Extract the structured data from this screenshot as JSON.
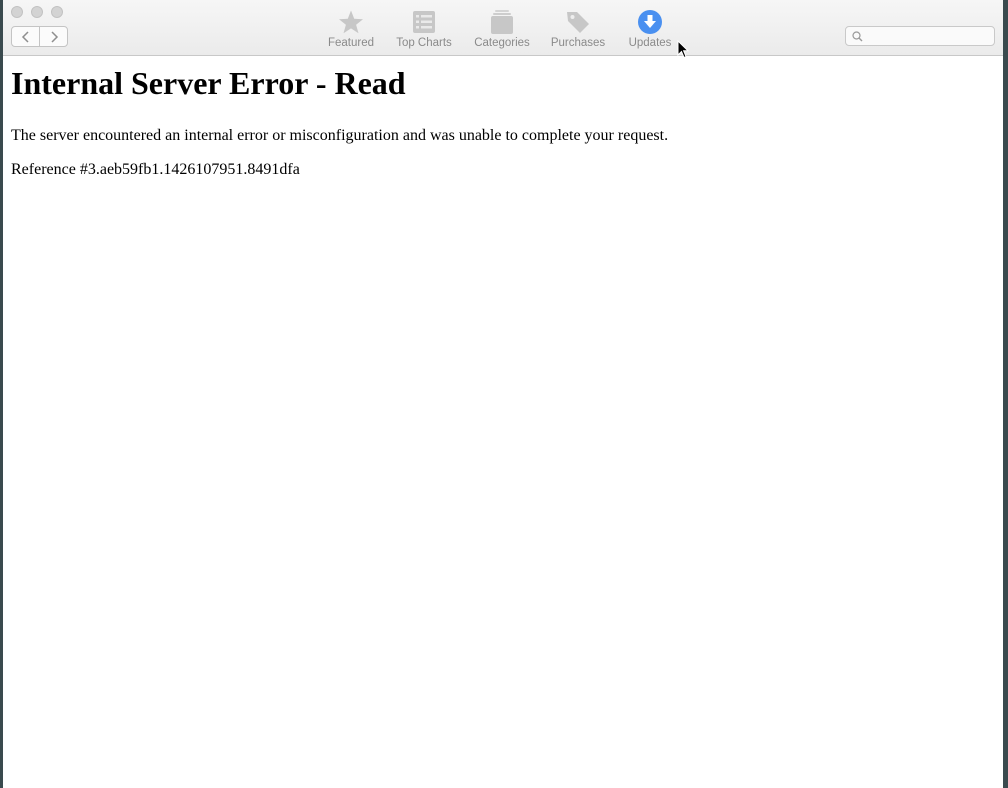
{
  "toolbar": {
    "items": [
      {
        "label": "Featured",
        "icon": "star-icon",
        "active": false
      },
      {
        "label": "Top Charts",
        "icon": "list-icon",
        "active": false
      },
      {
        "label": "Categories",
        "icon": "stack-icon",
        "active": false
      },
      {
        "label": "Purchases",
        "icon": "tag-icon",
        "active": false
      },
      {
        "label": "Updates",
        "icon": "download-icon",
        "active": true
      }
    ],
    "search_placeholder": ""
  },
  "page": {
    "heading": "Internal Server Error - Read",
    "message": "The server encountered an internal error or misconfiguration and was unable to complete your request.",
    "reference": "Reference #3.aeb59fb1.1426107951.8491dfa"
  },
  "colors": {
    "accent": "#4a90f0",
    "inactive_icon": "#c7c7c7",
    "label": "#8a8a8a"
  }
}
